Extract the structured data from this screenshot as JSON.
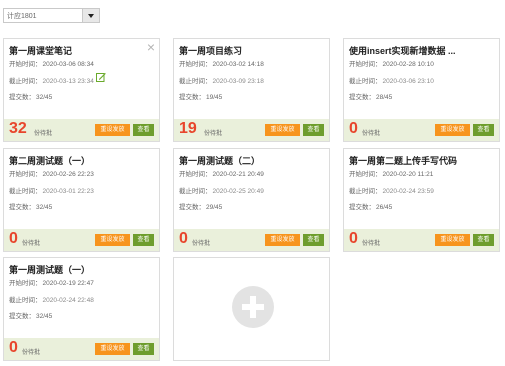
{
  "class_select": {
    "value": "计应1801"
  },
  "labels": {
    "start": "开始时间：",
    "end": "截止时间：",
    "submit": "提交数：",
    "wait": "份待批",
    "reset": "重设发放",
    "view": "查看"
  },
  "cards": [
    {
      "title": "第一周课堂笔记",
      "start": "2020-03-06 08:34",
      "end": "2020-03-13 23:34",
      "submit": "32/45",
      "pending": "32"
    },
    {
      "title": "第一周项目练习",
      "start": "2020-03-02 14:18",
      "end": "2020-03-09 23:18",
      "submit": "19/45",
      "pending": "19"
    },
    {
      "title": "使用insert实现新增数据 ...",
      "start": "2020-02-28 10:10",
      "end": "2020-03-06 23:10",
      "submit": "28/45",
      "pending": "0"
    },
    {
      "title": "第二周测试题（一）",
      "start": "2020-02-26 22:23",
      "end": "2020-03-01 22:23",
      "submit": "32/45",
      "pending": "0"
    },
    {
      "title": "第一周测试题（二）",
      "start": "2020-02-21 20:49",
      "end": "2020-02-25 20:49",
      "submit": "29/45",
      "pending": "0"
    },
    {
      "title": "第一周第二题上传手写代码",
      "start": "2020-02-20 11:21",
      "end": "2020-02-24 23:59",
      "submit": "26/45",
      "pending": "0"
    },
    {
      "title": "第一周测试题（一）",
      "start": "2020-02-19 22:47",
      "end": "2020-02-24 22:48",
      "submit": "32/45",
      "pending": "0"
    }
  ]
}
